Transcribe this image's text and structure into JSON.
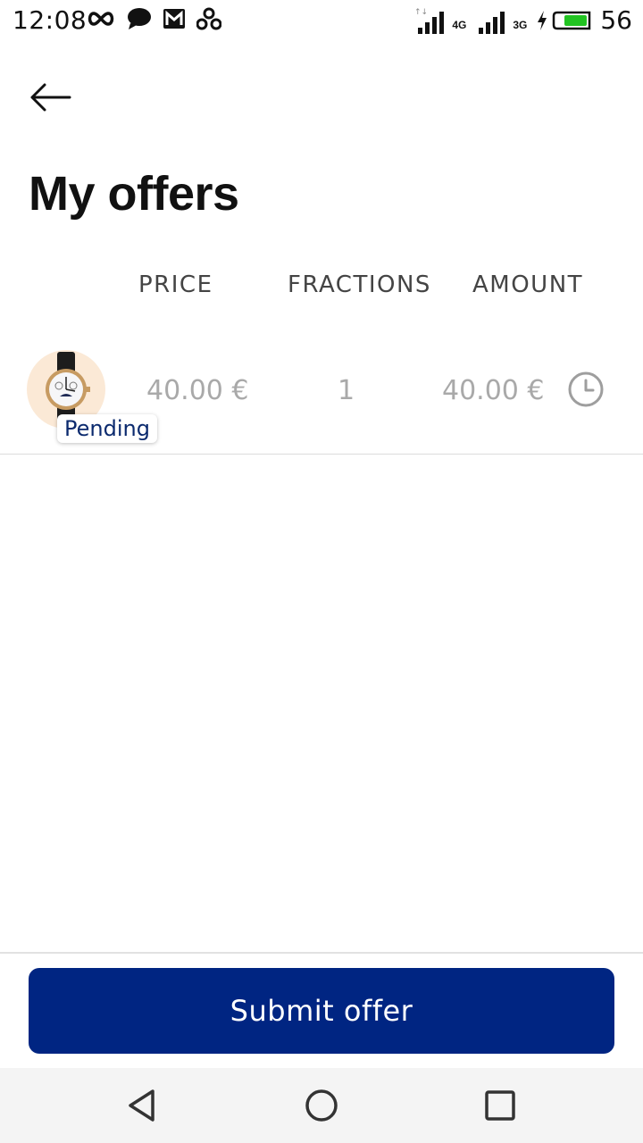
{
  "status_bar": {
    "time": "12:08",
    "network_1": "4G",
    "network_2": "3G",
    "battery": "56",
    "icons": [
      "infinity-icon",
      "chat-icon",
      "gmail-icon",
      "share-icon",
      "signal-icon",
      "signal-icon",
      "charging-icon",
      "battery-icon"
    ]
  },
  "header": {
    "back_icon": "arrow-left-icon",
    "title": "My offers"
  },
  "table": {
    "columns": [
      "PRICE",
      "FRACTIONS",
      "AMOUNT"
    ],
    "rows": [
      {
        "image": "watch-thumbnail",
        "status": "Pending",
        "price": "40.00 €",
        "fractions": "1",
        "amount": "40.00 €",
        "status_icon": "clock-icon"
      }
    ]
  },
  "actions": {
    "submit_label": "Submit offer"
  },
  "nav_bar": {
    "icons": [
      "back-triangle-icon",
      "home-circle-icon",
      "recent-square-icon"
    ]
  },
  "colors": {
    "primary": "#002582",
    "badge_text": "#0b2a6e",
    "muted_text": "#a9a9a9"
  }
}
